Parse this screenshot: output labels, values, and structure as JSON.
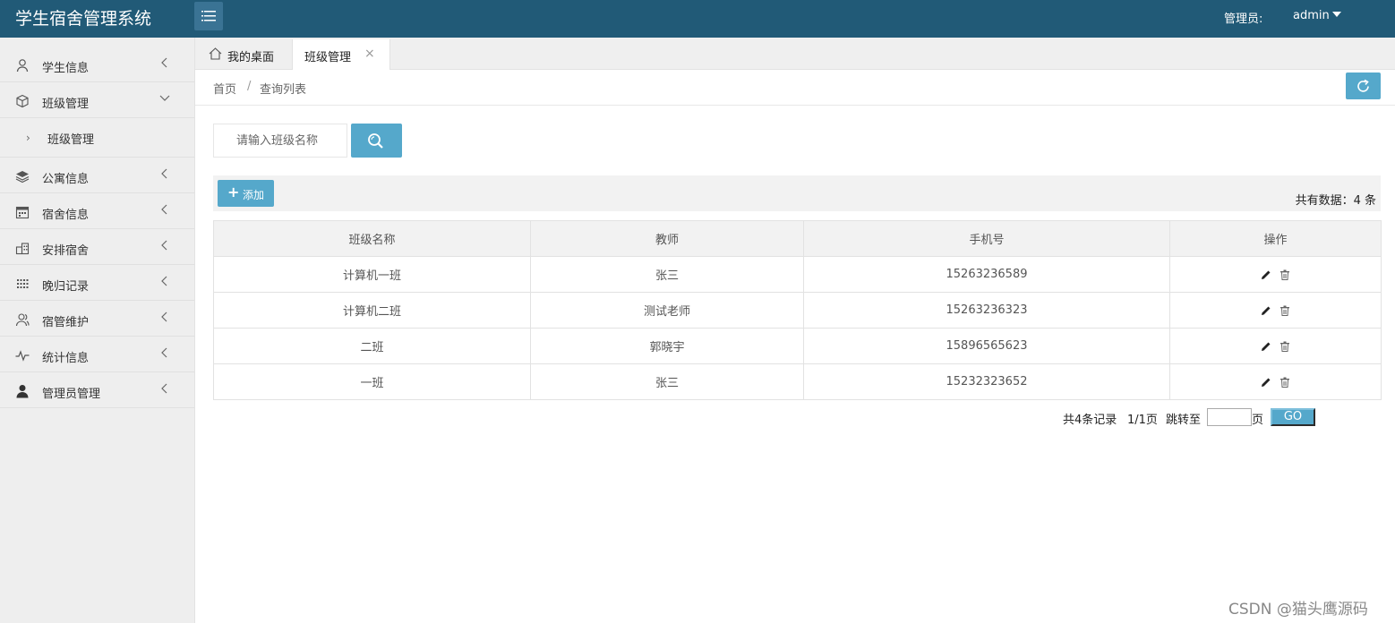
{
  "app": {
    "title": "学生宿舍管理系统",
    "admin_label": "管理员:",
    "admin_name": "admin"
  },
  "sidebar": {
    "items": [
      {
        "label": "学生信息",
        "icon": "user-icon"
      },
      {
        "label": "班级管理",
        "icon": "cube-icon",
        "expanded": true
      },
      {
        "label": "公寓信息",
        "icon": "layers-icon"
      },
      {
        "label": "宿舍信息",
        "icon": "calendar-icon"
      },
      {
        "label": "安排宿舍",
        "icon": "buildings-icon"
      },
      {
        "label": "晚归记录",
        "icon": "grid-dots-icon"
      },
      {
        "label": "宿管维护",
        "icon": "users-icon"
      },
      {
        "label": "统计信息",
        "icon": "pulse-icon"
      },
      {
        "label": "管理员管理",
        "icon": "admin-user-icon"
      }
    ],
    "sub_item": "班级管理"
  },
  "tabs": {
    "home": "我的桌面",
    "active": "班级管理",
    "close": "×"
  },
  "breadcrumb": {
    "home": "首页",
    "sep": "/",
    "current": "查询列表"
  },
  "search": {
    "placeholder": "请输入班级名称"
  },
  "toolbar": {
    "add_label": "添加",
    "total_text": "共有数据：4 条"
  },
  "table": {
    "headers": [
      "班级名称",
      "教师",
      "手机号",
      "操作"
    ],
    "rows": [
      {
        "name": "计算机一班",
        "teacher": "张三",
        "phone": "15263236589"
      },
      {
        "name": "计算机二班",
        "teacher": "测试老师",
        "phone": "15263236323"
      },
      {
        "name": "二班",
        "teacher": "郭晓宇",
        "phone": "15896565623"
      },
      {
        "name": "一班",
        "teacher": "张三",
        "phone": "15232323652"
      }
    ]
  },
  "pager": {
    "total": "共4条记录",
    "page": "1/1页",
    "jump": "跳转至",
    "unit": "页",
    "go": "GO"
  },
  "watermark": "CSDN @猫头鹰源码",
  "colors": {
    "header_bg": "#215a77",
    "accent": "#55a8cb",
    "sidebar_bg": "#eeeeee"
  }
}
